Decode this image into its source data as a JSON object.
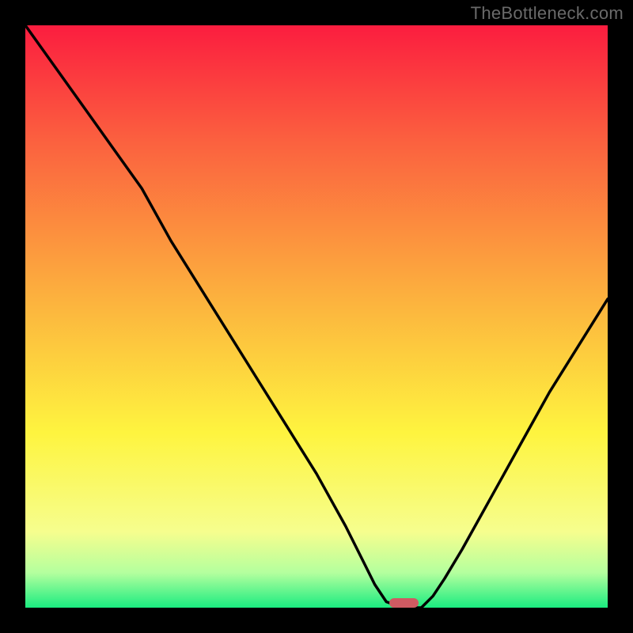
{
  "watermark": "TheBottleneck.com",
  "colors": {
    "black": "#000000",
    "red_top": "#fb1d3f",
    "red_mid": "#fb613f",
    "orange": "#fcac3e",
    "yellow": "#fef43f",
    "pale_yellow": "#f6fe8e",
    "light_green": "#b4ff9e",
    "green": "#1aec80",
    "curve": "#000000",
    "marker": "#cf5a62"
  },
  "plot": {
    "x_range": [
      0,
      100
    ],
    "y_range": [
      0,
      100
    ],
    "marker_x": 65,
    "marker_width_pct": 5
  },
  "chart_data": {
    "type": "line",
    "title": "",
    "xlabel": "",
    "ylabel": "",
    "x": [
      0,
      5,
      10,
      15,
      20,
      25,
      30,
      35,
      40,
      45,
      50,
      55,
      58,
      60,
      62,
      65,
      68,
      70,
      72,
      75,
      80,
      85,
      90,
      95,
      100
    ],
    "values": [
      100,
      93,
      86,
      79,
      72,
      63,
      55,
      47,
      39,
      31,
      23,
      14,
      8,
      4,
      1,
      0,
      0,
      2,
      5,
      10,
      19,
      28,
      37,
      45,
      53
    ],
    "ylim": [
      0,
      100
    ],
    "xlim": [
      0,
      100
    ],
    "annotations": [
      {
        "type": "marker",
        "x": 65,
        "y": 0,
        "label": ""
      }
    ]
  }
}
